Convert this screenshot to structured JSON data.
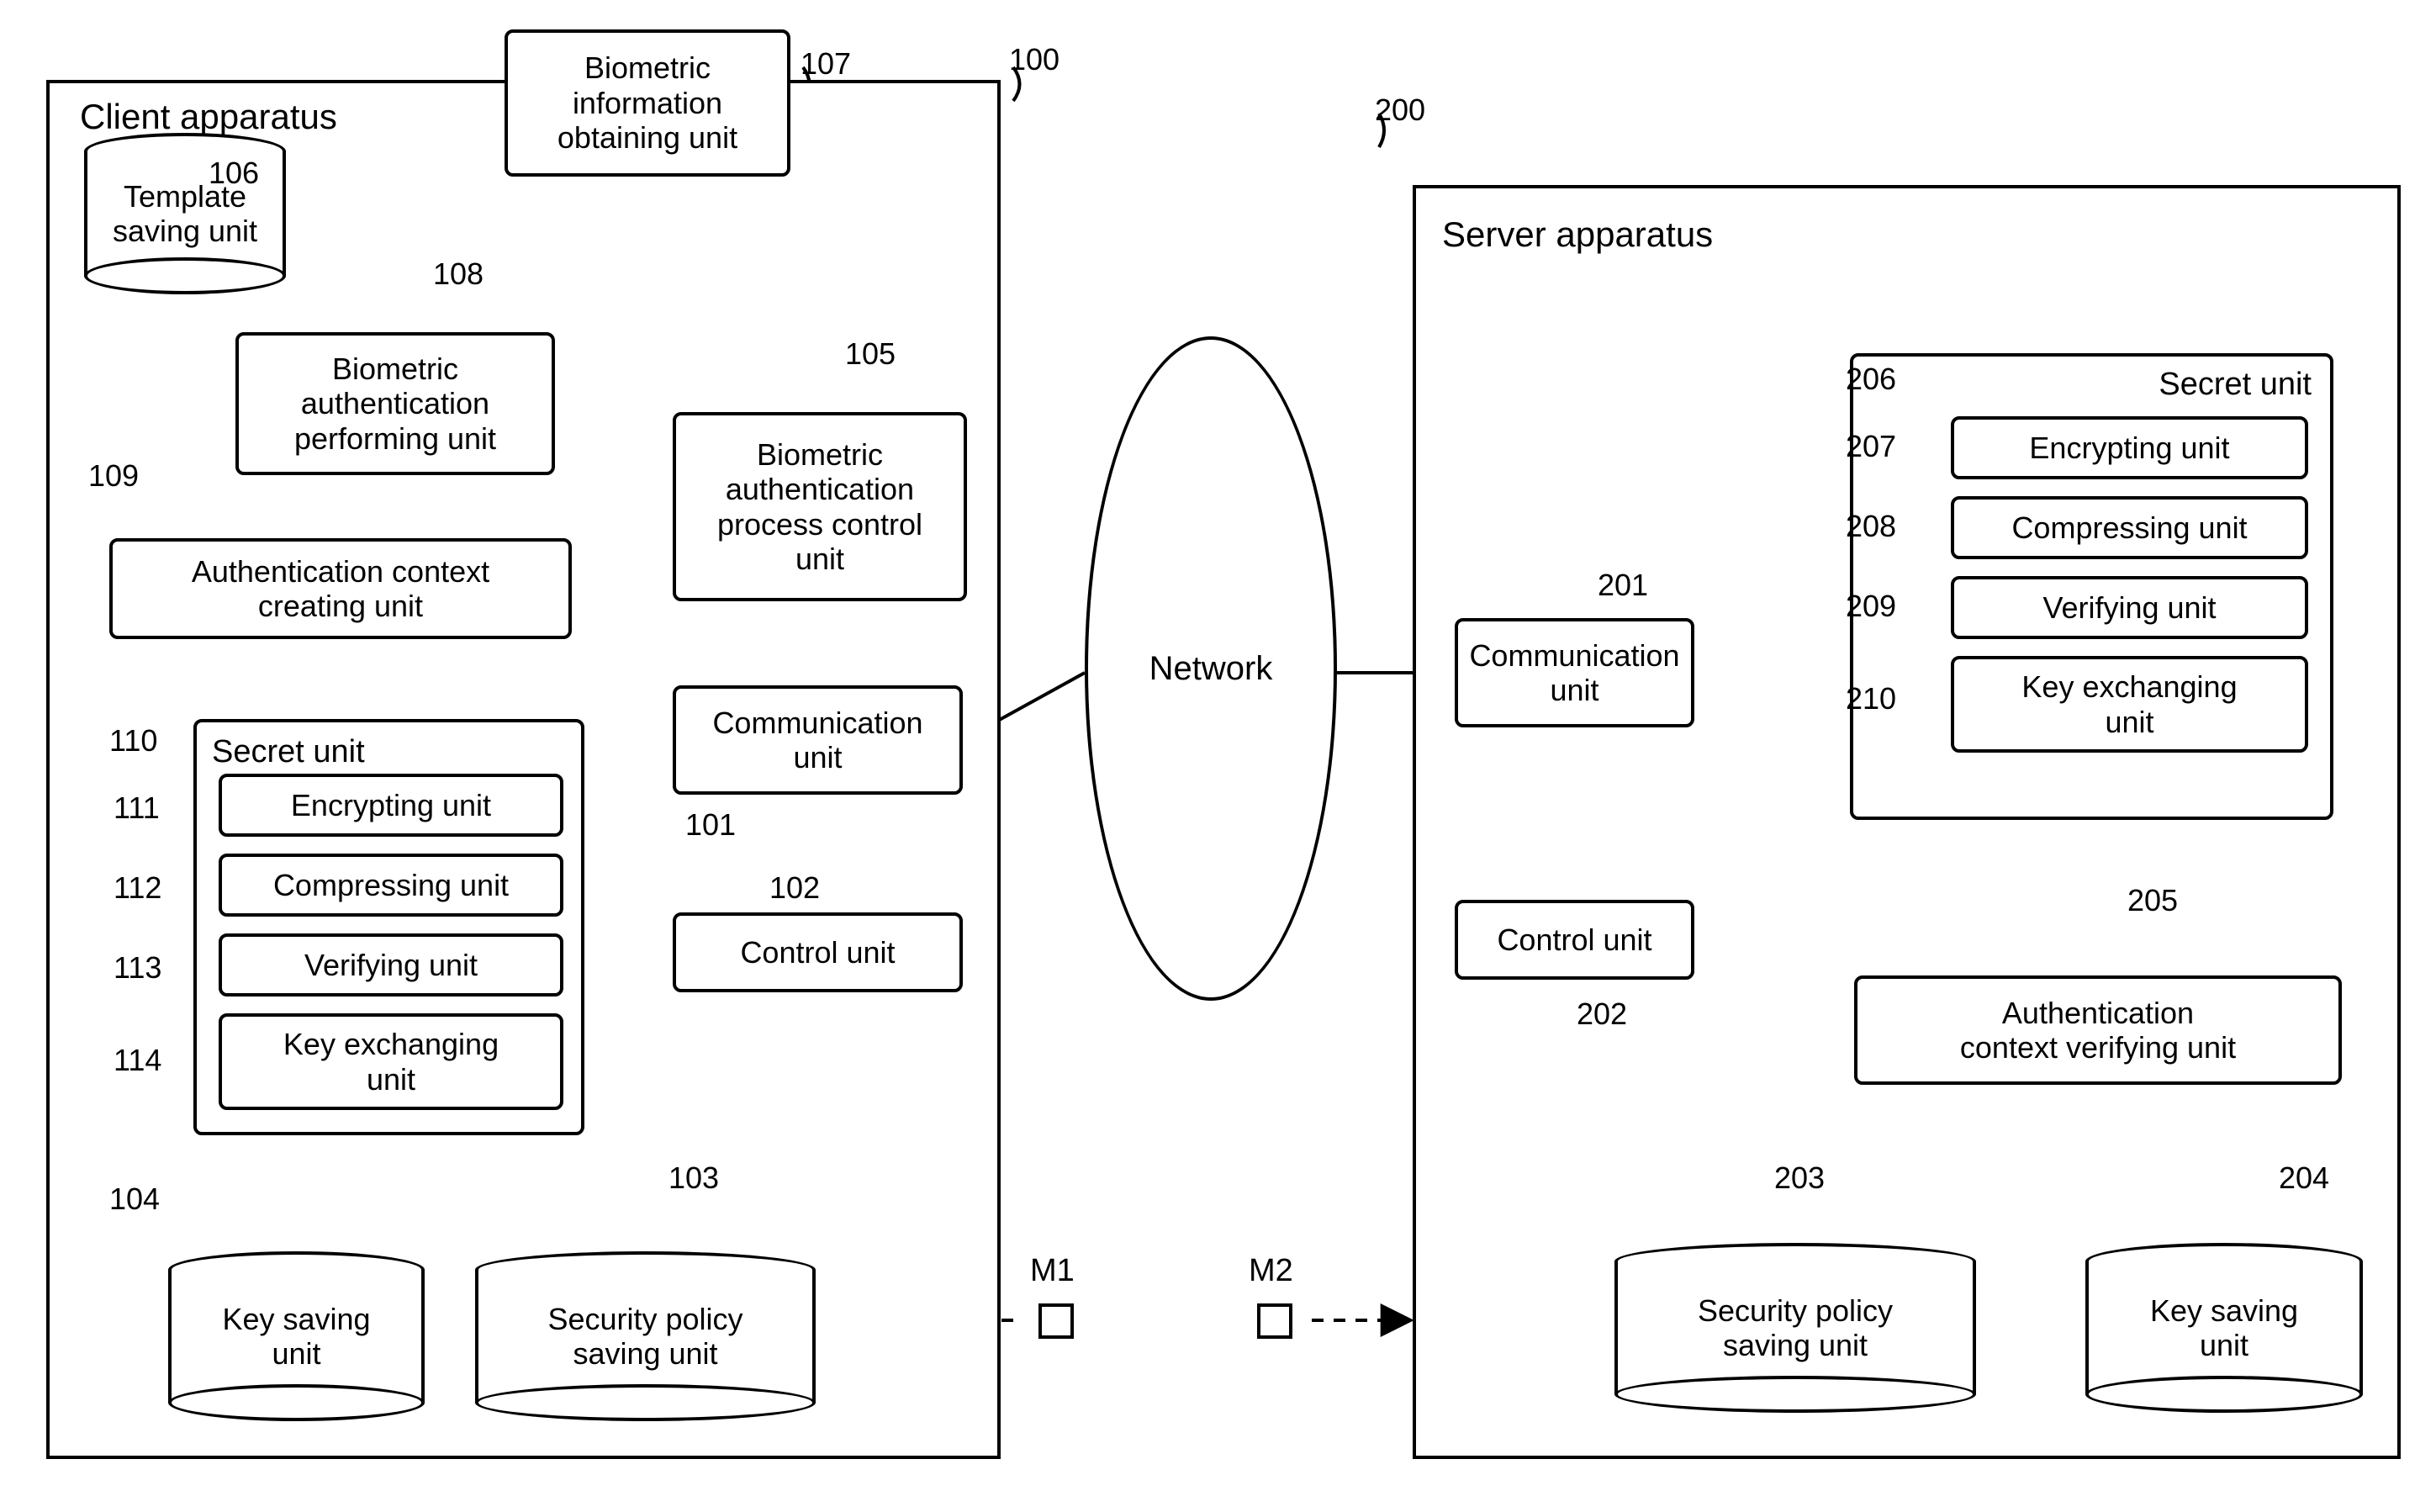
{
  "client": {
    "title": "Client apparatus",
    "ref": "100",
    "units": {
      "template_saving": {
        "label": "Template\nsaving unit",
        "ref": "106"
      },
      "bio_info_obtain": {
        "label": "Biometric\ninformation\nobtaining unit",
        "ref": "107"
      },
      "bio_auth_perform": {
        "label": "Biometric\nauthentication\nperforming unit",
        "ref": "108"
      },
      "bio_auth_proc_ctrl": {
        "label": "Biometric\nauthentication\nprocess control\nunit",
        "ref": "105"
      },
      "auth_ctx_create": {
        "label": "Authentication context\ncreating unit",
        "ref": "109"
      },
      "comm": {
        "label": "Communication\nunit",
        "ref": "101"
      },
      "control": {
        "label": "Control unit",
        "ref": "102"
      },
      "secret": {
        "title": "Secret unit",
        "ref": "110",
        "encrypt": {
          "label": "Encrypting unit",
          "ref": "111"
        },
        "compress": {
          "label": "Compressing unit",
          "ref": "112"
        },
        "verify": {
          "label": "Verifying unit",
          "ref": "113"
        },
        "keyex": {
          "label": "Key exchanging\nunit",
          "ref": "114"
        }
      },
      "sec_policy_save": {
        "label": "Security policy\nsaving unit",
        "ref": "103"
      },
      "key_save": {
        "label": "Key saving\nunit",
        "ref": "104"
      }
    }
  },
  "network": {
    "label": "Network"
  },
  "markers": {
    "m1": "M1",
    "m2": "M2"
  },
  "server": {
    "title": "Server apparatus",
    "ref": "200",
    "units": {
      "comm": {
        "label": "Communication\nunit",
        "ref": "201"
      },
      "control": {
        "label": "Control unit",
        "ref": "202"
      },
      "secret": {
        "title": "Secret unit",
        "ref": "206",
        "encrypt": {
          "label": "Encrypting unit",
          "ref": "207"
        },
        "compress": {
          "label": "Compressing unit",
          "ref": "208"
        },
        "verify": {
          "label": "Verifying unit",
          "ref": "209"
        },
        "keyex": {
          "label": "Key exchanging\nunit",
          "ref": "210"
        }
      },
      "auth_ctx_verify": {
        "label": "Authentication\ncontext verifying unit",
        "ref": "205"
      },
      "sec_policy_save": {
        "label": "Security policy\nsaving unit",
        "ref": "203"
      },
      "key_save": {
        "label": "Key saving\nunit",
        "ref": "204"
      }
    }
  }
}
